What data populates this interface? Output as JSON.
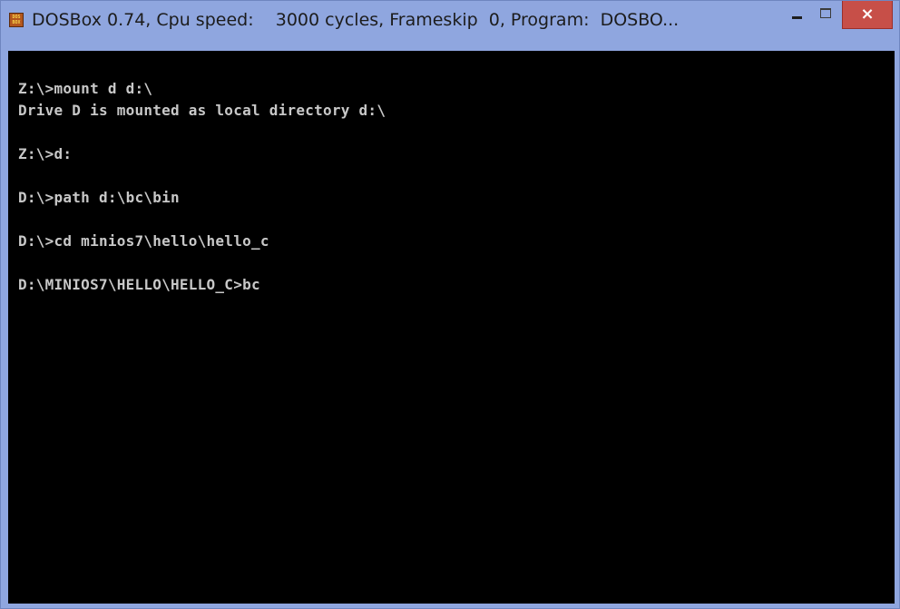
{
  "window": {
    "icon": "dosbox-app-icon",
    "icon_text_top": "DOS",
    "icon_text_bottom": "BOX",
    "title": "DOSBox 0.74, Cpu speed:    3000 cycles, Frameskip  0, Program:  DOSBO...",
    "controls": {
      "minimize_icon": "minimize-icon",
      "maximize_icon": "maximize-icon",
      "close_icon": "close-icon",
      "close_symbol": "×"
    }
  },
  "console": {
    "lines": [
      "Z:\\>mount d d:\\",
      "Drive D is mounted as local directory d:\\",
      "",
      "Z:\\>d:",
      "",
      "D:\\>path d:\\bc\\bin",
      "",
      "D:\\>cd minios7\\hello\\hello_c",
      "",
      "D:\\MINIOS7\\HELLO\\HELLO_C>bc"
    ]
  },
  "colors": {
    "titlebar": "#8fa6df",
    "close_button": "#c74f48",
    "console_background": "#000000",
    "console_text": "#c8c8c8"
  }
}
